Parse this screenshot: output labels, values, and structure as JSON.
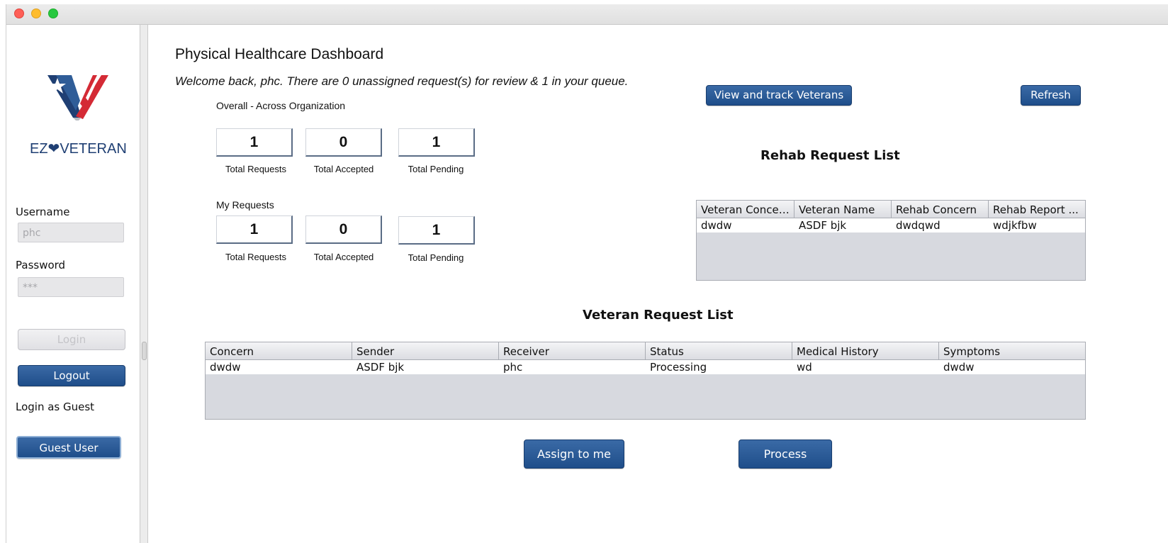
{
  "window": {
    "controls": [
      "close",
      "minimize",
      "zoom"
    ]
  },
  "sidebar": {
    "logo_text": "EZ❤VETERAN",
    "username_label": "Username",
    "username_value": "phc",
    "password_label": "Password",
    "password_value": "***",
    "login_label": "Login",
    "logout_label": "Logout",
    "guest_heading": "Login as Guest",
    "guest_button": "Guest User"
  },
  "main": {
    "title": "Physical Healthcare Dashboard",
    "welcome": "Welcome back, phc. There are 0 unassigned request(s) for review & 1 in your queue.",
    "overall": {
      "label": "Overall - Across Organization",
      "stats": [
        {
          "value": "1",
          "caption": "Total Requests"
        },
        {
          "value": "0",
          "caption": "Total Accepted"
        },
        {
          "value": "1",
          "caption": "Total Pending"
        }
      ]
    },
    "mine": {
      "label": "My Requests",
      "stats": [
        {
          "value": "1",
          "caption": "Total Requests"
        },
        {
          "value": "0",
          "caption": "Total Accepted"
        },
        {
          "value": "1",
          "caption": "Total Pending"
        }
      ]
    },
    "view_track_button": "View and track Veterans",
    "refresh_button": "Refresh",
    "rehab": {
      "title": "Rehab  Request List",
      "columns": [
        "Veteran Concern",
        "Veteran Name",
        "Rehab Concern",
        "Rehab Report ..."
      ],
      "rows": [
        [
          "dwdw",
          "ASDF bjk",
          "dwdqwd",
          "wdjkfbw"
        ]
      ]
    },
    "veteran": {
      "title": "Veteran Request List",
      "columns": [
        "Concern",
        "Sender",
        "Receiver",
        "Status",
        "Medical History",
        "Symptoms"
      ],
      "rows": [
        [
          "dwdw",
          "ASDF bjk",
          "phc",
          "Processing",
          "wd",
          "dwdw"
        ]
      ]
    },
    "assign_button": "Assign to me",
    "process_button": "Process"
  },
  "colors": {
    "button_blue": "#1f4e8a",
    "logo_blue": "#1f3f73",
    "logo_red": "#d42a35"
  }
}
